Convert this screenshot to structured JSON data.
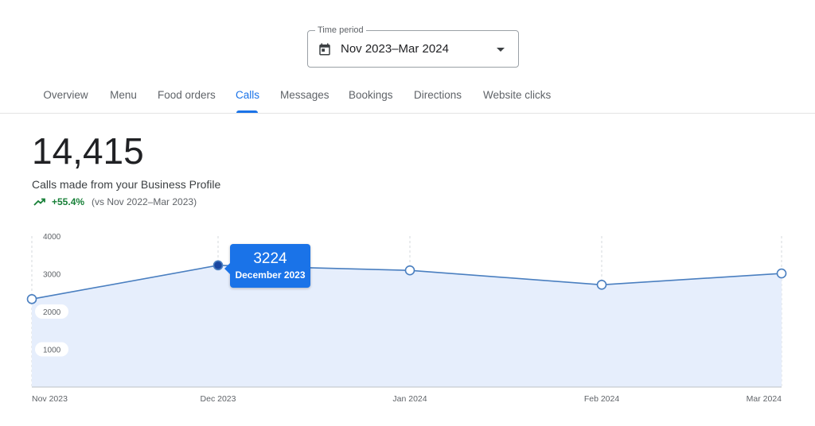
{
  "time_period": {
    "legend": "Time period",
    "value": "Nov 2023–Mar 2024",
    "icon": "calendar-icon",
    "dropdown_icon": "dropdown-arrow-icon"
  },
  "tabs": [
    {
      "label": "Overview",
      "active": false
    },
    {
      "label": "Menu",
      "active": false
    },
    {
      "label": "Food orders",
      "active": false
    },
    {
      "label": "Calls",
      "active": true
    },
    {
      "label": "Messages",
      "active": false
    },
    {
      "label": "Bookings",
      "active": false
    },
    {
      "label": "Directions",
      "active": false
    },
    {
      "label": "Website clicks",
      "active": false
    }
  ],
  "metric": {
    "value": "14,415",
    "label": "Calls made from your Business Profile",
    "trend_icon": "trending-up-icon",
    "change": "+55.4%",
    "comparison": "(vs Nov 2022–Mar 2023)"
  },
  "tooltip": {
    "value": "3224",
    "label": "December 2023"
  },
  "colors": {
    "accent": "#1a73e8",
    "line": "#4a7fc0",
    "area_fill": "#e6eefc",
    "positive": "#188038"
  },
  "chart_data": {
    "type": "area",
    "categories": [
      "Nov 2023",
      "Dec 2023",
      "Jan 2024",
      "Feb 2024",
      "Mar 2024"
    ],
    "series": [
      {
        "values": [
          2330,
          3224,
          3090,
          2710,
          3010
        ]
      }
    ],
    "yticks": [
      "4000",
      "3000",
      "2000",
      "1000"
    ],
    "ylim": [
      0,
      4000
    ],
    "highlighted_index": 1,
    "grid": "vertical dashed"
  }
}
